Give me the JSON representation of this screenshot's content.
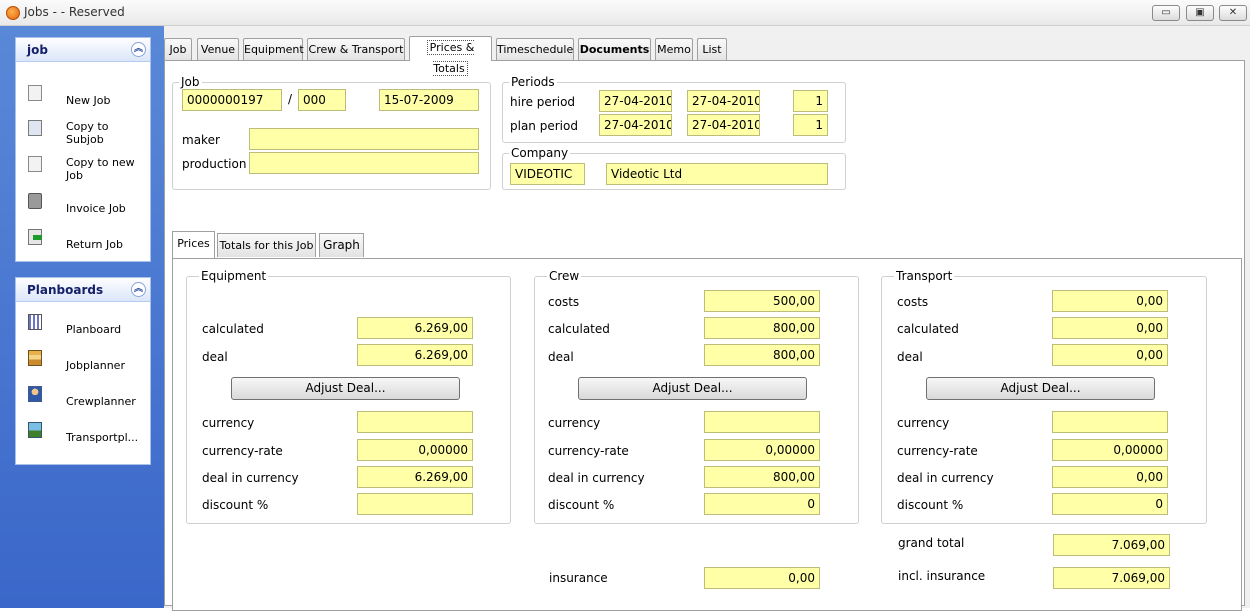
{
  "window": {
    "title": "Jobs -  - Reserved",
    "min": "▭",
    "max": "▣",
    "close": "✕"
  },
  "sidebar": {
    "job_panel": {
      "title": "job",
      "items": [
        {
          "label": "New Job",
          "icon": "new-document-icon"
        },
        {
          "label": "Copy to Subjob",
          "icon": "copy-icon"
        },
        {
          "label": "Copy to new Job",
          "icon": "copy-document-icon"
        },
        {
          "label": "Invoice Job",
          "icon": "printer-icon"
        },
        {
          "label": "Return Job",
          "icon": "return-arrow-icon"
        }
      ]
    },
    "planboards_panel": {
      "title": "Planboards",
      "items": [
        {
          "label": "Planboard",
          "icon": "planboard-icon"
        },
        {
          "label": "Jobplanner",
          "icon": "jobplanner-icon"
        },
        {
          "label": "Crewplanner",
          "icon": "crewplanner-icon"
        },
        {
          "label": "Transportpl...",
          "icon": "transportplanner-icon"
        }
      ]
    },
    "collapse_glyph": "︽"
  },
  "tabs": [
    "Job",
    "Venue",
    "Equipment",
    "Crew & Transport",
    "Prices & Totals",
    "Timeschedule",
    "Documents",
    "Memo",
    "List"
  ],
  "job": {
    "title": "Job",
    "number": "0000000197",
    "separator": "/",
    "sub": "000",
    "date": "15-07-2009",
    "maker_label": "maker",
    "maker": "",
    "production_label": "production",
    "production": ""
  },
  "periods": {
    "title": "Periods",
    "hire_label": "hire period",
    "hire_from": "27-04-2010",
    "hire_to": "27-04-2010",
    "hire_days": "1",
    "plan_label": "plan period",
    "plan_from": "27-04-2010",
    "plan_to": "27-04-2010",
    "plan_days": "1"
  },
  "company": {
    "title": "Company",
    "code": "VIDEOTIC",
    "name": "Videotic Ltd"
  },
  "subtabs": [
    "Prices",
    "Totals for this Job",
    "Graph"
  ],
  "labels": {
    "costs": "costs",
    "calculated": "calculated",
    "deal": "deal",
    "adjust": "Adjust Deal...",
    "currency": "currency",
    "currency_rate": "currency-rate",
    "deal_in_currency": "deal in currency",
    "discount": "discount %"
  },
  "equipment": {
    "title": "Equipment",
    "calculated": "6.269,00",
    "deal": "6.269,00",
    "currency": "",
    "currency_rate": "0,00000",
    "deal_in_currency": "6.269,00",
    "discount": ""
  },
  "crew": {
    "title": "Crew",
    "costs": "500,00",
    "calculated": "800,00",
    "deal": "800,00",
    "currency": "",
    "currency_rate": "0,00000",
    "deal_in_currency": "800,00",
    "discount": "0"
  },
  "transport": {
    "title": "Transport",
    "costs": "0,00",
    "calculated": "0,00",
    "deal": "0,00",
    "currency": "",
    "currency_rate": "0,00000",
    "deal_in_currency": "0,00",
    "discount": "0"
  },
  "totals": {
    "insurance_label": "insurance",
    "insurance": "0,00",
    "grand_total_label": "grand total",
    "grand_total": "7.069,00",
    "incl_insurance_label": "incl. insurance",
    "incl_insurance": "7.069,00"
  },
  "colors": {
    "field_bg": "#ffffa8",
    "sidebar": "#3a67c9"
  }
}
